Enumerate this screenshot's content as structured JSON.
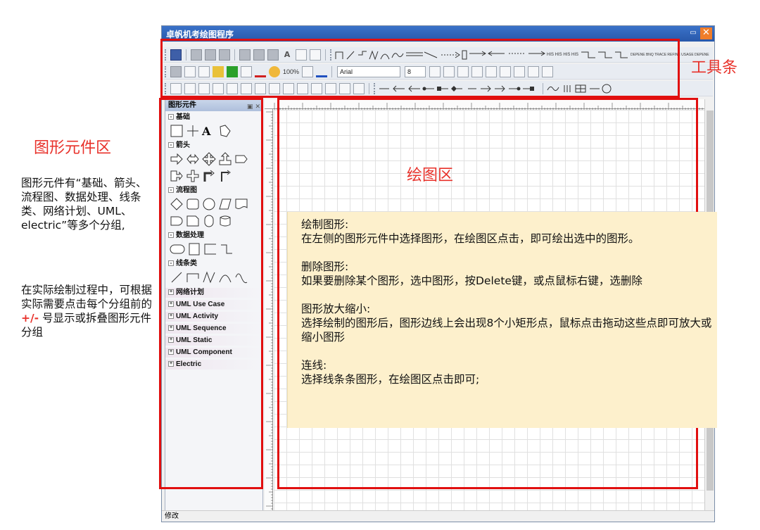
{
  "window": {
    "title": "卓帆机考绘图程序",
    "min_glyph": "▭",
    "close_glyph": "✕",
    "status": "修改"
  },
  "toolbar": {
    "zoom": "100%",
    "font_name": "Arial",
    "font_size": "8",
    "arrow_labels": "HIS HIS HIS HIS",
    "connector_labels": "DEPENE BNQ TRACE REFINE USAGE DEPENE"
  },
  "palette": {
    "title": "图形元件",
    "groups": {
      "basic": "基础",
      "arrows": "箭头",
      "flowchart": "流程图",
      "data": "数据处理",
      "lines": "线条类",
      "network": "网络计划",
      "uml_usecase": "UML Use Case",
      "uml_activity": "UML Activity",
      "uml_sequence": "UML Sequence",
      "uml_static": "UML Static",
      "uml_component": "UML Component",
      "electric": "Electric"
    },
    "text_tool_glyph": "A"
  },
  "annotations": {
    "toolbar_label": "工具条",
    "palette_label": "图形元件区",
    "canvas_label": "绘图区",
    "palette_desc": "图形元件有“基础、箭头、流程图、数据处理、线条类、网络计划、UML、electric”等多个分组,",
    "palette_desc2_pre": "在实际绘制过程中，可根据实际需要点击每个分组前的",
    "palette_desc2_pm": "+/-",
    "palette_desc2_post": "号显示或拆叠图形元件分组"
  },
  "note": {
    "draw_title": "绘制图形:",
    "draw_body": "在左侧的图形元件中选择图形，在绘图区点击，即可绘出选中的图形。",
    "delete_title": "删除图形:",
    "delete_body": "如果要删除某个图形，选中图形，按Delete键，或点鼠标右键，选删除",
    "resize_title": "图形放大缩小:",
    "resize_body": "选择绘制的图形后，图形边线上会出现8个小矩形点，鼠标点击拖动这些点即可放大或缩小图形",
    "connect_title": "连线:",
    "connect_body": "选择线条条图形，在绘图区点击即可;"
  }
}
